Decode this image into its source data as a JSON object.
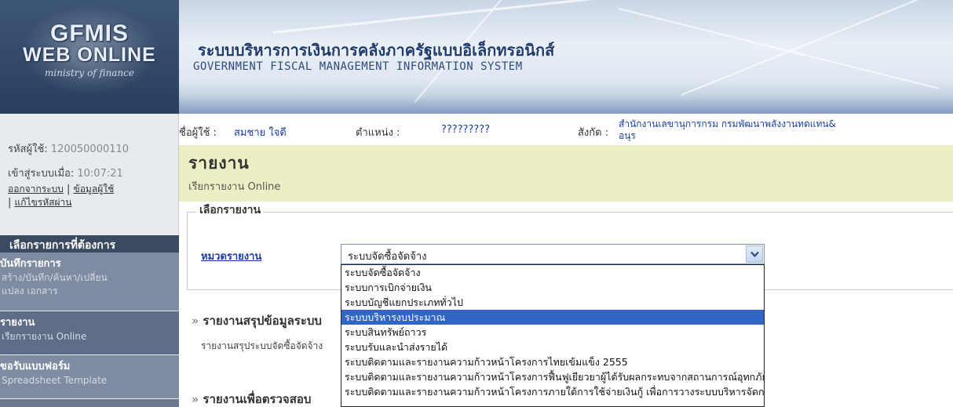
{
  "header": {
    "logo_line1": "GFMIS",
    "logo_line2": "WEB ONLINE",
    "logo_tagline": "ministry of finance",
    "title_th": "ระบบบริหารการเงินการคลังภาครัฐแบบอิเล็กทรอนิกส์",
    "title_en": "GOVERNMENT FISCAL MANAGEMENT INFORMATION SYSTEM"
  },
  "user": {
    "id_label": "รหัสผู้ใช้:",
    "id_value": "120050000110",
    "login_label": "เข้าสู่ระบบเมื่อ:",
    "login_time": "10:07:21",
    "logout_link": "ออกจากระบบ",
    "userinfo_link": "ข้อมูลผู้ใช้",
    "change_password_link": "แก้ไขรหัสผ่าน",
    "separator": "|"
  },
  "infobar": {
    "name_label": "ชื่อผู้ใช้ :",
    "name_value": "สมชาย ใจดี",
    "position_label": "ตำแหน่ง :",
    "position_value": "?????????",
    "org_label": "สังกัด :",
    "org_value_1": "สำนักงานเลขานุการกรม กรมพัฒนาพลังงานทดแทน&",
    "org_value_2": "อนุร"
  },
  "sidebar": {
    "menu_title": "เลือกรายการที่ต้องการ",
    "items": [
      {
        "title": "บันทึกรายการ",
        "sub1": "สร้าง/บันทึก/ค้นหา/เปลี่ยน",
        "sub2": "แปลง เอกสาร"
      },
      {
        "title": "รายงาน",
        "sub1": "เรียกรายงาน Online"
      },
      {
        "title": "ขอรับแบบฟอร์ม",
        "sub1": "Spreadsheet Template"
      }
    ]
  },
  "page": {
    "heading": "รายงาน",
    "subheading": "เรียกรายงาน Online",
    "fieldset_legend": "เลือกรายงาน",
    "category_label": "หมวดรายงาน",
    "selected_value": "ระบบจัดซื้อจัดจ้าง",
    "options": [
      "ระบบจัดซื้อจัดจ้าง",
      "ระบบการเบิกจ่ายเงิน",
      "ระบบบัญชีแยกประเภททั่วไป",
      "ระบบบริหารงบประมาณ",
      "ระบบสินทรัพย์ถาวร",
      "ระบบรับและนำส่งรายได้",
      "ระบบติดตามและรายงานความก้าวหน้าโครงการไทยเข้มแข็ง 2555",
      "ระบบติดตามและรายงานความก้าวหน้าโครงการฟื้นฟูเยียวยาผู้ได้รับผลกระทบจากสถานการณ์อุทกภัย",
      "ระบบติดตามและรายงานความก้าวหน้าโครงการภายใต้การใช้จ่ายเงินกู้ เพื่อการวางระบบบริหารจัดการน้ำและ"
    ],
    "highlighted_index": 3,
    "section1_prefix": "»",
    "section1_title": "รายงานสรุปข้อมูลระบบ",
    "section1_sub": "รายงานสรุประบบจัดซื้อจัดจ้าง",
    "section2_prefix": "»",
    "section2_title": "รายงานเพื่อตรวจสอบ"
  }
}
